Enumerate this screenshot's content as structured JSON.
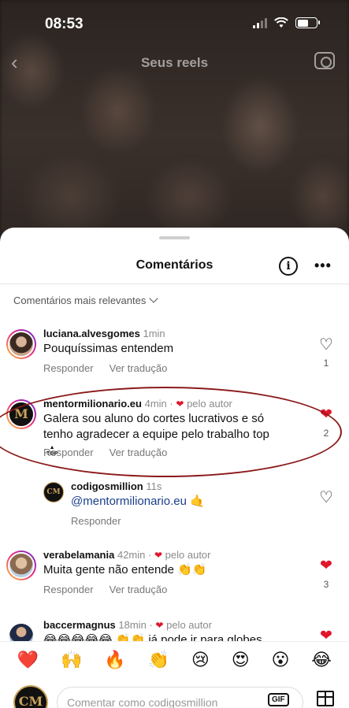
{
  "status": {
    "time": "08:53"
  },
  "topbar": {
    "title": "Seus reels"
  },
  "sheet": {
    "title": "Comentários",
    "sort_label": "Comentários mais relevantes"
  },
  "labels": {
    "reply": "Responder",
    "translate": "Ver tradução",
    "by_author": "pelo autor"
  },
  "comments": [
    {
      "username": "luciana.alvesgomes",
      "age": "1min",
      "text": "Pouquíssimas entendem",
      "likes": "1",
      "liked": false
    },
    {
      "username": "mentormilionario.eu",
      "age": "4min",
      "text": "Galera sou aluno do cortes lucrativos e só tenho agradecer a equipe pelo trabalho top",
      "likes": "2",
      "liked": true
    },
    {
      "username": "codigosmillion",
      "age": "11s",
      "mention": "@mentormilionario.eu",
      "emoji": "🤙"
    },
    {
      "username": "verabelamania",
      "age": "42min",
      "text": "Muita gente não entende 👏👏",
      "likes": "3",
      "liked": true
    },
    {
      "username": "baccermagnus",
      "age": "18min",
      "text": "😂😂😂😂😂 👏👏 já pode ir para globes",
      "liked": true
    }
  ],
  "reactions": [
    "❤️",
    "🙌",
    "🔥",
    "👏",
    "😢",
    "😍",
    "😮",
    "😂"
  ],
  "composer": {
    "placeholder": "Comentar como codigosmillion",
    "gif_label": "GIF",
    "avatar_text": "CM"
  },
  "colors": {
    "accent_red": "#e0162b",
    "mention_blue": "#1a3e8a",
    "circle_annotation": "#8b1a1a"
  }
}
